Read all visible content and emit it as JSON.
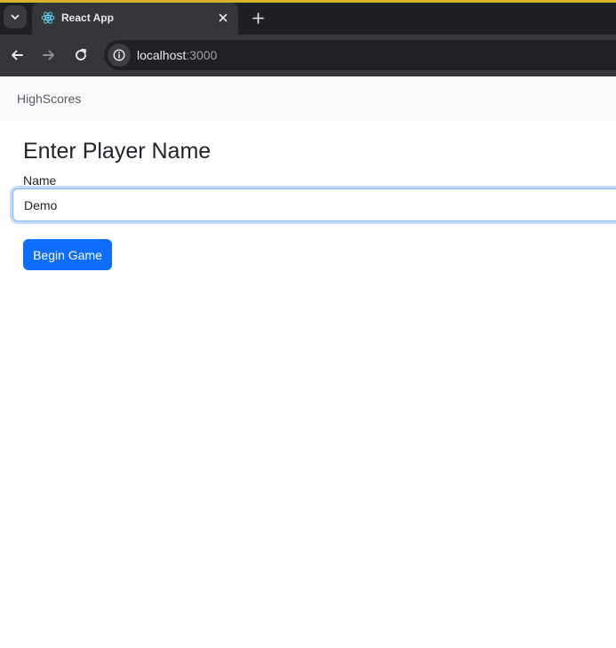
{
  "browser": {
    "tab": {
      "title": "React App",
      "favicon": "react-logo-icon"
    },
    "address_bar": {
      "host": "localhost",
      "port": ":3000"
    },
    "icons": {
      "tab_menu": "chevron-down-icon",
      "close": "close-icon",
      "new_tab": "plus-icon",
      "back": "arrow-left-icon",
      "forward": "arrow-right-icon",
      "reload": "reload-icon",
      "site_info": "info-icon"
    },
    "colors": {
      "accent_strip": "#d7b529",
      "tabstrip": "#1f2023",
      "toolbar": "#35363a",
      "omnibox": "#202124"
    }
  },
  "page": {
    "navbar": {
      "link": "HighScores"
    },
    "title": "Enter Player Name",
    "form": {
      "name_label": "Name",
      "name_value": "Demo",
      "submit_label": "Begin Game"
    },
    "colors": {
      "primary": "#0d6efd",
      "navbar_bg": "#f8f9fa",
      "text": "#212529"
    }
  }
}
